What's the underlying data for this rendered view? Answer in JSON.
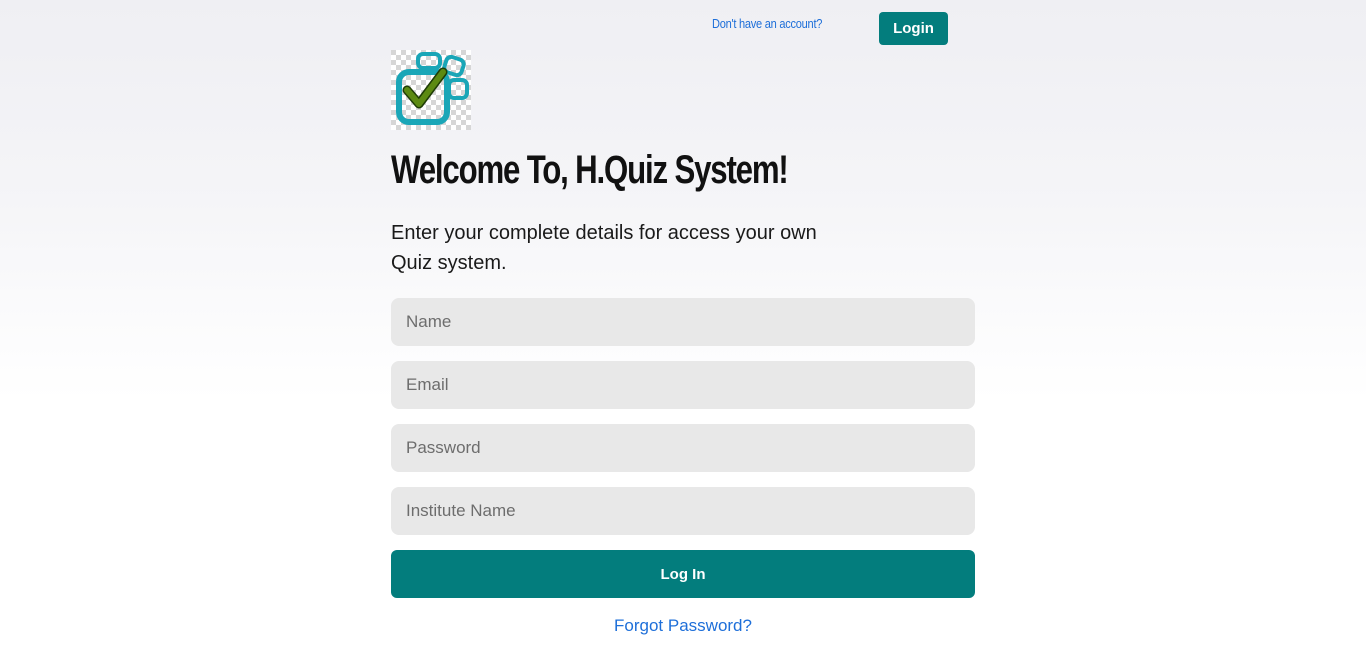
{
  "header": {
    "signup_link": "Don't have an account?",
    "login_button": "Login"
  },
  "logo": {
    "icon": "quiz-checkmark-logo",
    "colors": {
      "frame": "#1aa6b7",
      "check": "#5c8a12"
    }
  },
  "main": {
    "title": "Welcome To, H.Quiz System!",
    "subtitle": "Enter your complete details for access your own Quiz system."
  },
  "form": {
    "name_placeholder": "Name",
    "email_placeholder": "Email",
    "password_placeholder": "Password",
    "institute_placeholder": "Institute Name",
    "submit_label": "Log In",
    "forgot_link": "Forgot Password?"
  },
  "colors": {
    "accent": "#037d7d",
    "link": "#1e6fd9",
    "field_bg": "#e8e8e8"
  }
}
